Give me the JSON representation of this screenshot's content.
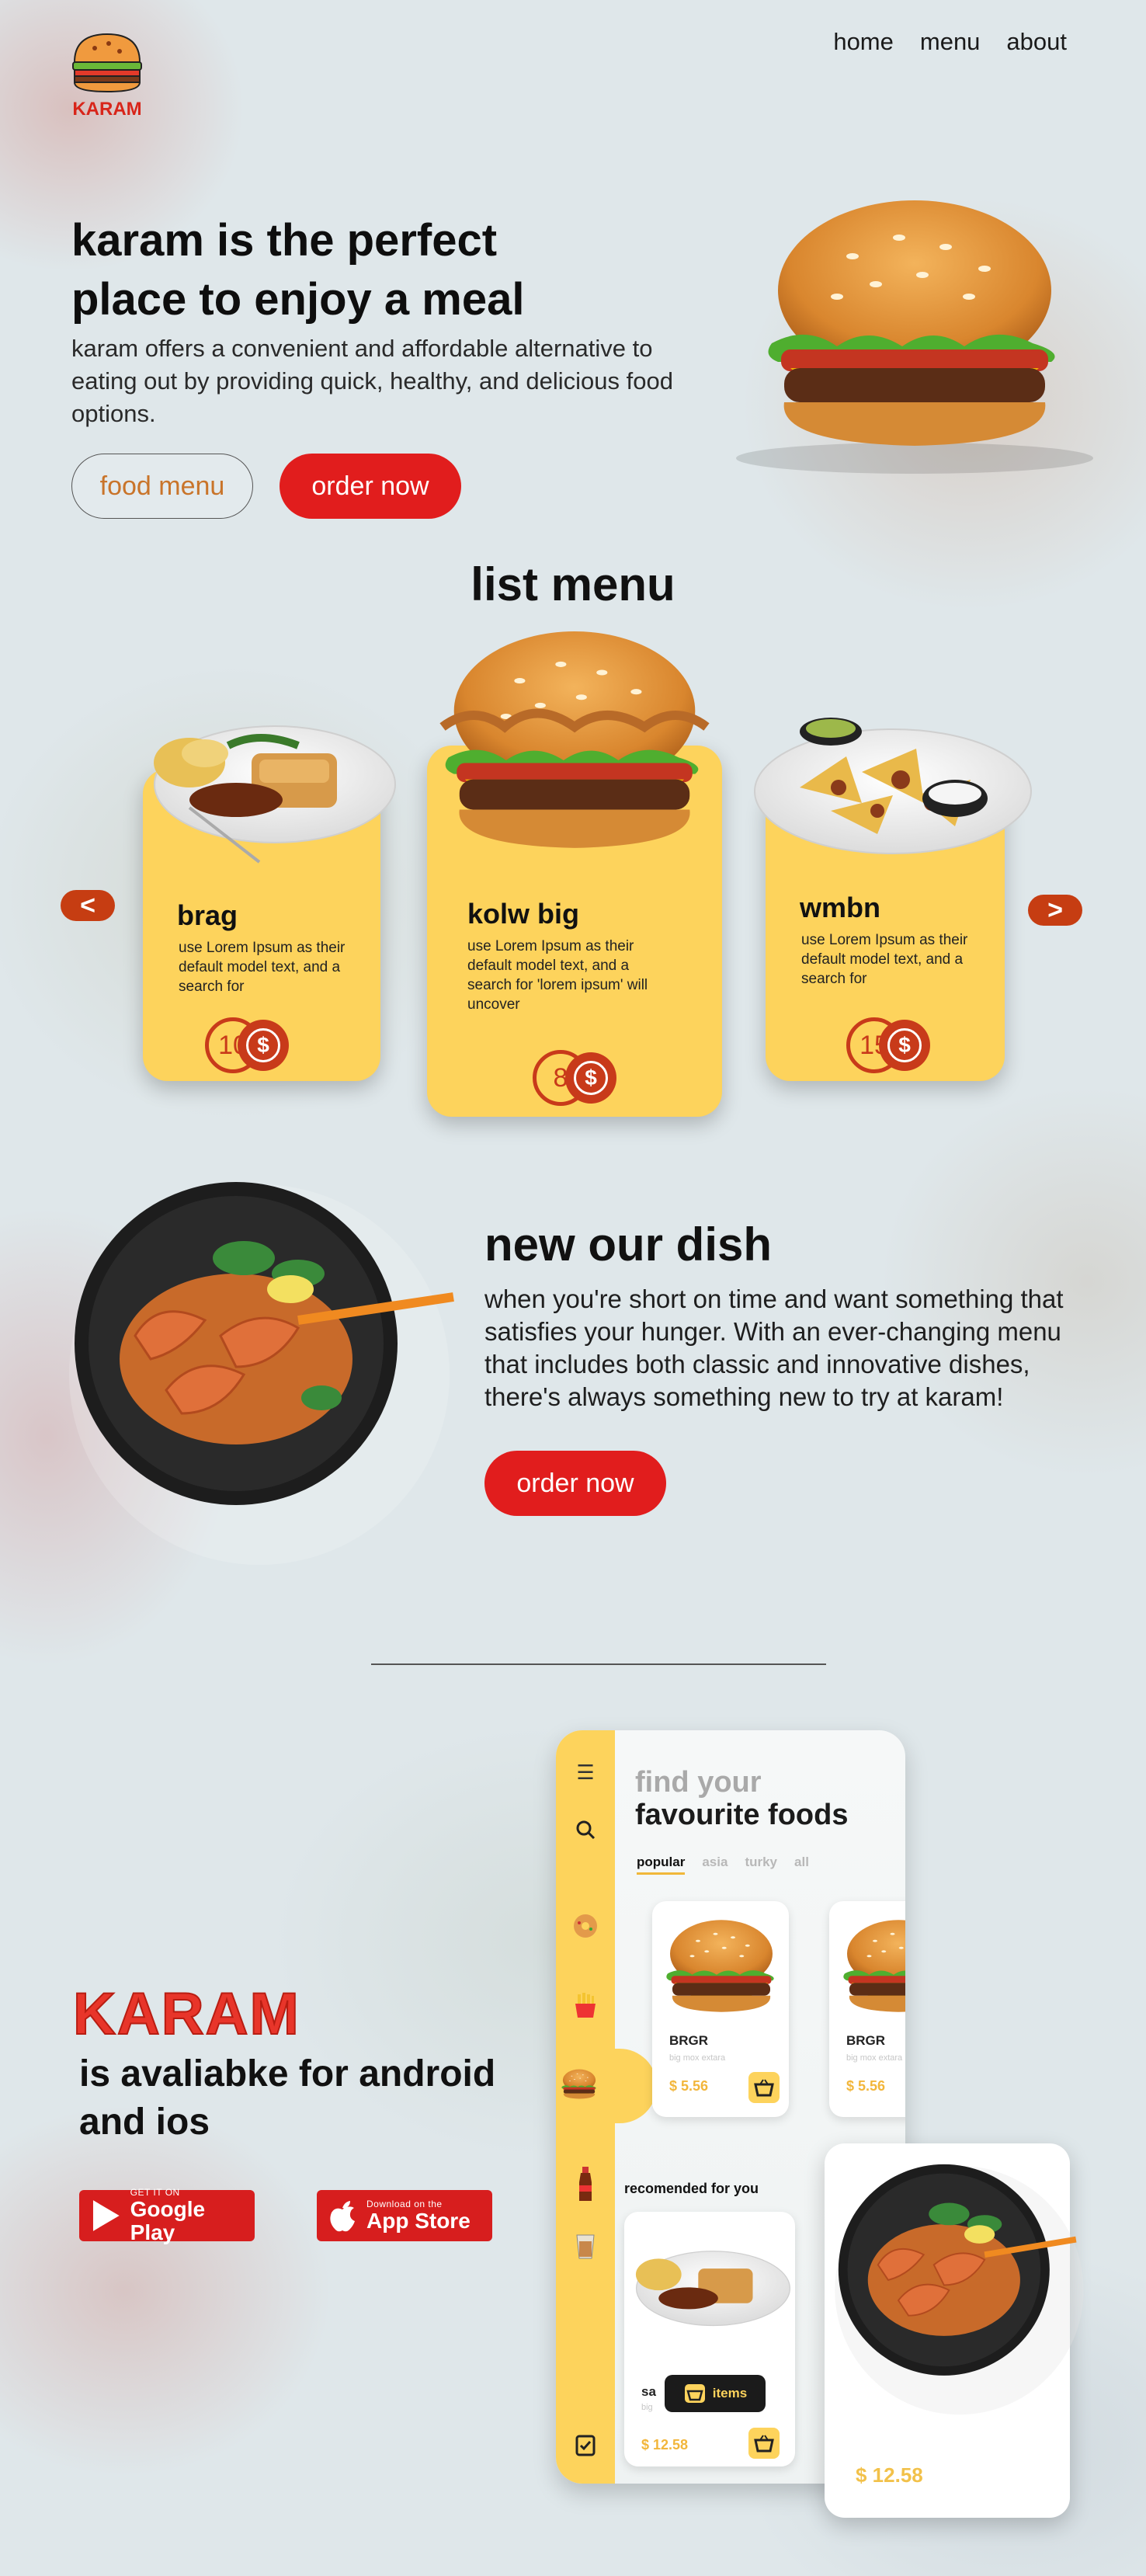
{
  "header": {
    "logo_text": "KARAM",
    "nav": [
      "home",
      "menu",
      "about"
    ]
  },
  "hero": {
    "title_line1": "karam is the perfect",
    "title_line2": "place to enjoy a meal",
    "description": "karam offers a convenient and affordable alternative to eating out by providing quick, healthy, and delicious food options.",
    "food_menu_label": "food menu",
    "order_label": "order now"
  },
  "list_menu": {
    "title": "list menu",
    "prev_label": "<",
    "next_label": ">",
    "cards": [
      {
        "name": "brag",
        "desc": "use Lorem Ipsum as their default model text, and a search for",
        "price": "10",
        "currency": "$"
      },
      {
        "name": "kolw big",
        "desc": "use Lorem Ipsum as their default model text, and a search for 'lorem ipsum' will uncover",
        "price": "8",
        "currency": "$"
      },
      {
        "name": "wmbn",
        "desc": "use Lorem Ipsum as their default model text, and a search for",
        "price": "15",
        "currency": "$"
      }
    ]
  },
  "new_dish": {
    "title": "new our dish",
    "description": "when you're short on time and want something that satisfies your hunger. With an ever-changing menu that includes both classic and innovative dishes, there's always something new to try at karam!",
    "order_label": "order now"
  },
  "app": {
    "brand": "KARAM",
    "tagline": "is avaliabke for android and ios",
    "google": {
      "sub": "GET IT ON",
      "main": "Google Play"
    },
    "apple": {
      "sub": "Download on the",
      "main": "App Store"
    },
    "phone": {
      "find": "find your",
      "fav": "favourite foods",
      "tabs": [
        "popular",
        "asia",
        "turky",
        "all"
      ],
      "popular_cards": [
        {
          "name": "BRGR",
          "sub": "big mox extara",
          "price": "$ 5.56"
        },
        {
          "name": "BRGR",
          "sub": "big mox extara",
          "price": "$ 5.56"
        }
      ],
      "recommended_title": "recomended for you",
      "recommended_card": {
        "name": "sa",
        "sub": "big",
        "price": "$ 12.58"
      },
      "items_label": "items"
    },
    "detail_card": {
      "price": "$ 12.58"
    }
  },
  "colors": {
    "accent_red": "#e11d1d",
    "card_yellow": "#fdd35c",
    "coin_red": "#c83a1a",
    "price_yellow": "#f2b63b"
  }
}
